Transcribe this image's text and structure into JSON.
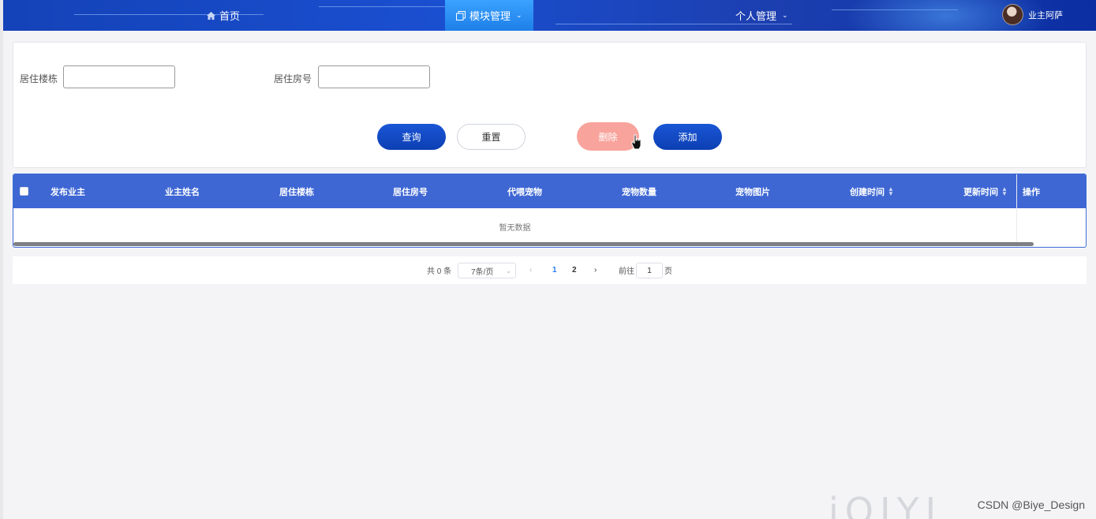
{
  "nav": {
    "home_label": "首页",
    "modules_label": "模块管理",
    "personal_label": "个人管理",
    "user_name": "业主阿萨"
  },
  "search": {
    "building_label": "居住楼栋",
    "building_value": "",
    "room_label": "居住房号",
    "room_value": ""
  },
  "actions": {
    "query_label": "查询",
    "reset_label": "重置",
    "delete_label": "删除",
    "add_label": "添加"
  },
  "table": {
    "columns": [
      "发布业主",
      "业主姓名",
      "居住楼栋",
      "居住房号",
      "代喂宠物",
      "宠物数量",
      "宠物图片",
      "创建时间",
      "更新时间",
      "操作"
    ],
    "empty_text": "暂无数据"
  },
  "pagination": {
    "total_text": "共 0 条",
    "page_size": "7条/页",
    "pages": [
      "1",
      "2"
    ],
    "current_page": "1",
    "goto_label": "前往",
    "goto_value": "1",
    "page_suffix": "页"
  },
  "watermark": "CSDN @Biye_Design",
  "theme": {
    "nav_blue": "#1a4fd0",
    "active_tab": "#2b8ff5",
    "table_header": "#3e67d4",
    "delete_color": "#f8a39c"
  }
}
